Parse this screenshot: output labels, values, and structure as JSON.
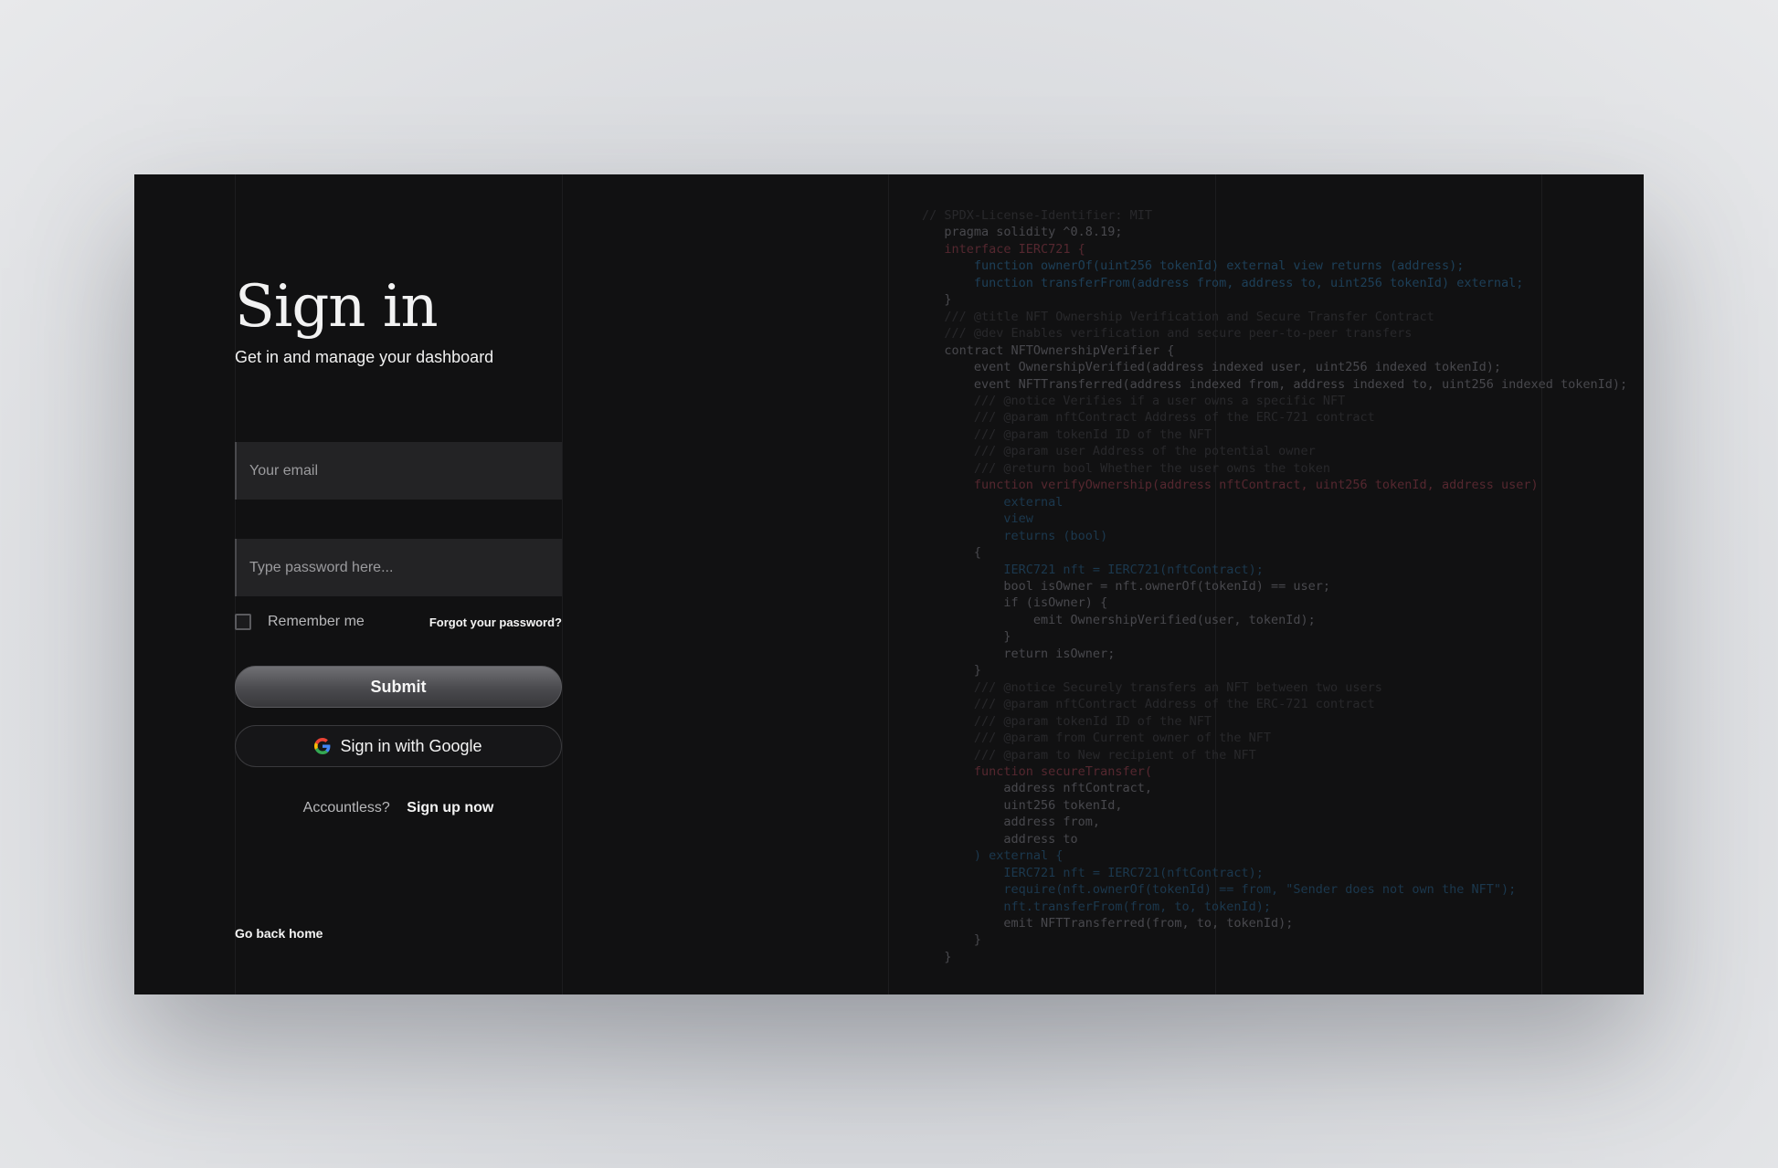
{
  "auth": {
    "title": "Sign in",
    "subtitle": "Get in and manage your dashboard",
    "email_placeholder": "Your email",
    "password_placeholder": "Type password here...",
    "remember_label": "Remember me",
    "forgot_label": "Forgot your password?",
    "submit_label": "Submit",
    "google_label": "Sign in with Google",
    "accountless_text": "Accountless?",
    "signup_label": "Sign up now",
    "home_label": "Go back home"
  },
  "code_lines": [
    {
      "t": "// SPDX-License-Identifier: MIT",
      "c": "c"
    },
    {
      "t": "   pragma solidity ^0.8.19;",
      "c": "p"
    },
    {
      "t": "   interface IERC721 {",
      "c": "k"
    },
    {
      "t": "       function ownerOf(uint256 tokenId) external view returns (address);",
      "c": "f"
    },
    {
      "t": "       function transferFrom(address from, address to, uint256 tokenId) external;",
      "c": "f"
    },
    {
      "t": "   }",
      "c": "p"
    },
    {
      "t": "   /// @title NFT Ownership Verification and Secure Transfer Contract",
      "c": "c"
    },
    {
      "t": "   /// @dev Enables verification and secure peer-to-peer transfers",
      "c": "c"
    },
    {
      "t": "   contract NFTOwnershipVerifier {",
      "c": "p"
    },
    {
      "t": "       event OwnershipVerified(address indexed user, uint256 indexed tokenId);",
      "c": "p"
    },
    {
      "t": "       event NFTTransferred(address indexed from, address indexed to, uint256 indexed tokenId);",
      "c": "p"
    },
    {
      "t": "       /// @notice Verifies if a user owns a specific NFT",
      "c": "c"
    },
    {
      "t": "       /// @param nftContract Address of the ERC-721 contract",
      "c": "c"
    },
    {
      "t": "       /// @param tokenId ID of the NFT",
      "c": "c"
    },
    {
      "t": "       /// @param user Address of the potential owner",
      "c": "c"
    },
    {
      "t": "       /// @return bool Whether the user owns the token",
      "c": "c"
    },
    {
      "t": "       function verifyOwnership(address nftContract, uint256 tokenId, address user)",
      "c": "k"
    },
    {
      "t": "           external",
      "c": "s"
    },
    {
      "t": "           view",
      "c": "s"
    },
    {
      "t": "           returns (bool)",
      "c": "s"
    },
    {
      "t": "       {",
      "c": "p"
    },
    {
      "t": "           IERC721 nft = IERC721(nftContract);",
      "c": "s"
    },
    {
      "t": "           bool isOwner = nft.ownerOf(tokenId) == user;",
      "c": "p"
    },
    {
      "t": "           if (isOwner) {",
      "c": "p"
    },
    {
      "t": "               emit OwnershipVerified(user, tokenId);",
      "c": "p"
    },
    {
      "t": "           }",
      "c": "p"
    },
    {
      "t": "           return isOwner;",
      "c": "p"
    },
    {
      "t": "       }",
      "c": "p"
    },
    {
      "t": "       /// @notice Securely transfers an NFT between two users",
      "c": "c"
    },
    {
      "t": "       /// @param nftContract Address of the ERC-721 contract",
      "c": "c"
    },
    {
      "t": "       /// @param tokenId ID of the NFT",
      "c": "c"
    },
    {
      "t": "       /// @param from Current owner of the NFT",
      "c": "c"
    },
    {
      "t": "       /// @param to New recipient of the NFT",
      "c": "c"
    },
    {
      "t": "       function secureTransfer(",
      "c": "k"
    },
    {
      "t": "           address nftContract,",
      "c": "p"
    },
    {
      "t": "           uint256 tokenId,",
      "c": "p"
    },
    {
      "t": "           address from,",
      "c": "p"
    },
    {
      "t": "           address to",
      "c": "p"
    },
    {
      "t": "       ) external {",
      "c": "s"
    },
    {
      "t": "           IERC721 nft = IERC721(nftContract);",
      "c": "s"
    },
    {
      "t": "           require(nft.ownerOf(tokenId) == from, \"Sender does not own the NFT\");",
      "c": "s"
    },
    {
      "t": "           nft.transferFrom(from, to, tokenId);",
      "c": "s"
    },
    {
      "t": "           emit NFTTransferred(from, to, tokenId);",
      "c": "p"
    },
    {
      "t": "       }",
      "c": "p"
    },
    {
      "t": "   }",
      "c": "p"
    }
  ]
}
